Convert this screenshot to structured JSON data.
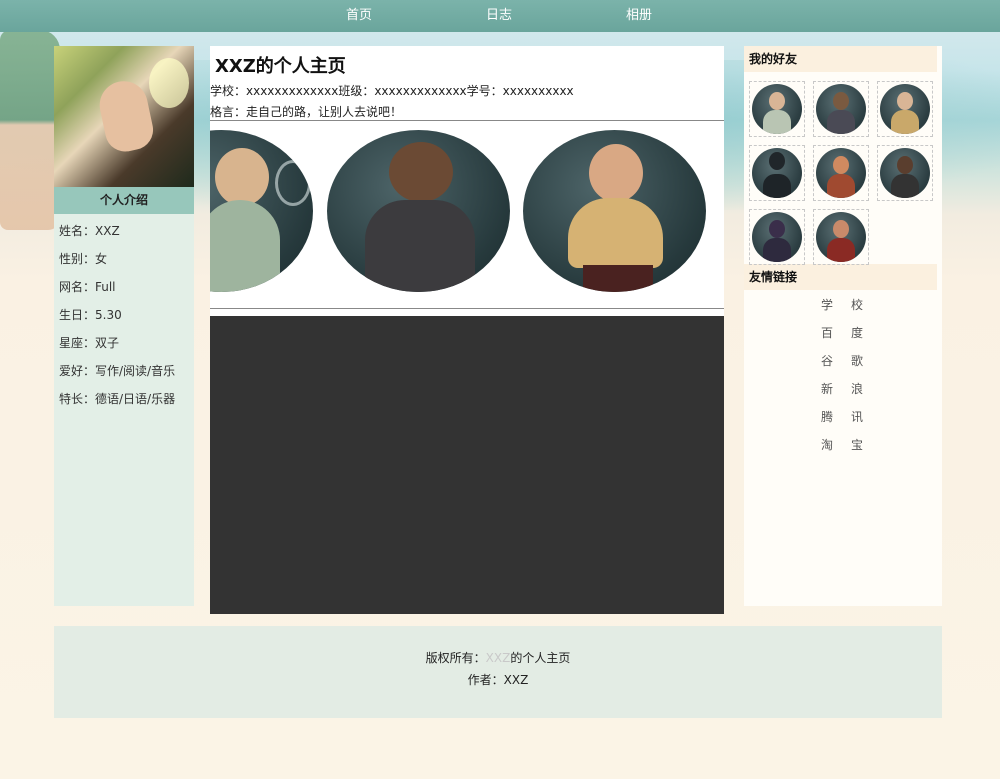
{
  "nav": {
    "items": [
      "首页",
      "日志",
      "相册"
    ]
  },
  "profile": {
    "intro_title": "个人介绍",
    "details": [
      "姓名：XXZ",
      "性别：女",
      "网名：Full",
      "生日：5.30",
      "星座：双子",
      "爱好：写作/阅读/音乐",
      "特长：德语/日语/乐器"
    ]
  },
  "main": {
    "title": "XXZ的个人主页",
    "info": "学校：xxxxxxxxxxxxx班级：xxxxxxxxxxxxx学号：xxxxxxxxxx",
    "motto": "格言：走自己的路，让别人去说吧！"
  },
  "friends": {
    "title": "我的好友",
    "count": 8
  },
  "links": {
    "title": "友情链接",
    "items": [
      "学校",
      "百度",
      "谷歌",
      "新浪",
      "腾讯",
      "淘宝"
    ]
  },
  "footer": {
    "copyright_prefix": "版权所有：",
    "copyright_name": "XXZ",
    "copyright_suffix": "的个人主页",
    "author": "作者：XXZ"
  },
  "colors": {
    "nav_bg": "#6fa9a0",
    "intro_header": "#97c7bb",
    "video_bg": "#333333",
    "footer_bg": "#e3ece4"
  }
}
